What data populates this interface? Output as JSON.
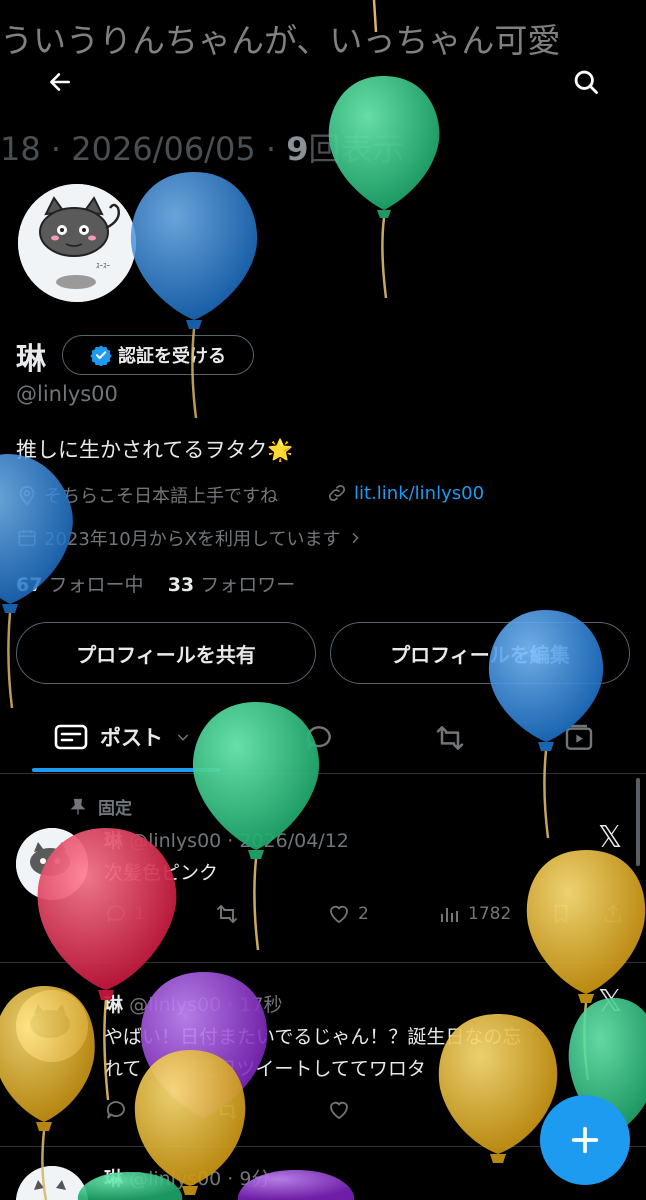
{
  "header": {
    "banner_text": "ういうりんちゃんが、いっちゃん可愛",
    "back_icon": "arrow-left-icon",
    "search_icon": "search-icon"
  },
  "ghost_meta": {
    "prefix": "18 · 2026/06/05 · ",
    "views_count": "9",
    "views_label": "回表示"
  },
  "profile": {
    "name": "琳",
    "verify_label": "認証を受ける",
    "handle": "@linlys00",
    "bio": "推しに生かされてるヲタク🌟",
    "location": "そちらこそ日本語上手ですね",
    "link": "lit.link/linlys00",
    "joined": "2023年10月からXを利用しています",
    "following_count": "67",
    "following_label": "フォロー中",
    "followers_count": "33",
    "followers_label": "フォロワー"
  },
  "buttons": {
    "share": "プロフィールを共有",
    "edit": "プロフィールを編集"
  },
  "tabs": {
    "posts_label": "ポスト"
  },
  "posts": [
    {
      "pinned_label": "固定",
      "name": "琳",
      "handle_time": "@linlys00 · 2026/04/12",
      "text": "次髪色ピンク",
      "replies": "1",
      "likes": "2",
      "views": "1782"
    },
    {
      "name": "琳",
      "handle_time": "@linlys00 · 17秒",
      "text_line1": "やばい！日付またいでるじゃん！？誕生日なの忘",
      "text_line2": "れて　　誕生日ツイートしててワロタ"
    },
    {
      "name": "琳",
      "handle_time": "@linlys00 · 9分"
    }
  ],
  "colors": {
    "accent": "#1d9bf0",
    "balloon_green": "#2ecc8a",
    "balloon_blue": "#2f8fe0",
    "balloon_red": "#e23a5a",
    "balloon_yellow": "#e8b92a",
    "balloon_purple": "#9b3fd6"
  }
}
